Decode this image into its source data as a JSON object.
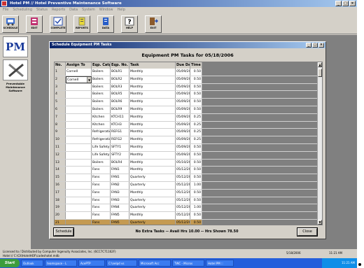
{
  "app": {
    "title": "Hotel PM // Hotel Preventive Maintenance Software",
    "menu": [
      "File",
      "Scheduling",
      "Status",
      "Reports",
      "Data",
      "System",
      "Window",
      "Help"
    ]
  },
  "toolbar": [
    {
      "label": "SCHEDULE",
      "icon": "schedule-icon"
    },
    {
      "label": "EDIT",
      "icon": "edit-icon"
    },
    {
      "label": "COMPLETE",
      "icon": "complete-icon"
    },
    {
      "label": "REPORTS",
      "icon": "reports-icon"
    },
    {
      "label": "DATA",
      "icon": "data-icon"
    },
    {
      "label": "HELP",
      "icon": "help-icon"
    },
    {
      "label": "EXIT",
      "icon": "exit-icon"
    }
  ],
  "sidebar": {
    "logo_text": "PM",
    "caption": "Preventable Maintenance Software"
  },
  "window": {
    "title": "Schedule Equipment PM Tasks",
    "heading": "Equipment PM Tasks for 05/18/2006",
    "columns": [
      "No.",
      "Assign To",
      "Eqp. Catg",
      "Eqp. No.",
      "Task",
      "Due Date",
      "Time"
    ],
    "rows": [
      [
        "1",
        "Cornell",
        "Boilers",
        "BOLR1",
        "Monthly",
        "05/09/2006",
        "0.50"
      ],
      [
        "2",
        "Cornell",
        "Boilers",
        "BOLR2",
        "Monthly",
        "05/09/2006",
        "0.50"
      ],
      [
        "3",
        "",
        "Boilers",
        "BOLR3",
        "Monthly",
        "05/09/2006",
        "0.50"
      ],
      [
        "4",
        "",
        "Boilers",
        "BOLR5",
        "Monthly",
        "05/09/2006",
        "0.50"
      ],
      [
        "5",
        "",
        "Boilers",
        "BOLR6",
        "Monthly",
        "05/09/2006",
        "0.50"
      ],
      [
        "6",
        "",
        "Boilers",
        "BOLR9",
        "Monthly",
        "05/09/2006",
        "0.50"
      ],
      [
        "7",
        "",
        "Kitchen",
        "KTCH11",
        "Monthly",
        "05/09/2006",
        "0.25"
      ],
      [
        "8",
        "",
        "Kitchen",
        "KTCH3",
        "Monthly",
        "05/09/2006",
        "0.25"
      ],
      [
        "9",
        "",
        "Refrigeration",
        "REFG1",
        "Monthly",
        "05/09/2006",
        "0.25"
      ],
      [
        "10",
        "",
        "Refrigeration",
        "REFG2",
        "Monthly",
        "05/09/2006",
        "0.25"
      ],
      [
        "11",
        "",
        "Life Safety",
        "SFTY1",
        "Monthly",
        "05/09/2006",
        "0.50"
      ],
      [
        "12",
        "",
        "Life Safety",
        "SFTY2",
        "Monthly",
        "05/09/2006",
        "0.50"
      ],
      [
        "13",
        "",
        "Boilers",
        "BOLR4",
        "Monthly",
        "05/10/2006",
        "0.50"
      ],
      [
        "14",
        "",
        "Fans",
        "FAN1",
        "Monthly",
        "05/12/2006",
        "0.50"
      ],
      [
        "15",
        "",
        "Fans",
        "FAN1",
        "Quarterly",
        "05/12/2006",
        "0.50"
      ],
      [
        "16",
        "",
        "Fans",
        "FAN2",
        "Quarterly",
        "05/12/2006",
        "1.00"
      ],
      [
        "17",
        "",
        "Fans",
        "FAN3",
        "Monthly",
        "05/12/2006",
        "0.50"
      ],
      [
        "18",
        "",
        "Fans",
        "FAN3",
        "Quarterly",
        "05/12/2006",
        "0.50"
      ],
      [
        "19",
        "",
        "Fans",
        "FAN4",
        "Quarterly",
        "05/12/2006",
        "1.00"
      ],
      [
        "20",
        "",
        "Fans",
        "FAN5",
        "Monthly",
        "05/12/2006",
        "0.50"
      ],
      [
        "21",
        "",
        "Fans",
        "FAN5",
        "Quarterly",
        "05/12/2006",
        "0.50"
      ]
    ],
    "schedule_button": "Schedule",
    "summary": "No Extra Tasks -- Avail Hrs 10.00 -- Hrs Shown 78.50",
    "close_button": "Close"
  },
  "status": {
    "line1": "Licensed to / Distributed by Computer Ingenuity Associates, Inc. (6CC7C71162F)",
    "line2": "Hotel // C:\\Cit\\HotelHOF\\cadeshotel.mdb",
    "date": "5/18/2006",
    "time": "11:21 AM"
  },
  "taskbar": {
    "start": "Start",
    "tasks": [
      "Outlook",
      "teamspace - L",
      "AcePTP",
      "C:\\nelpd vs",
      "Microsoft Acc",
      "TWC - Micros",
      "Hotel PM ::"
    ],
    "clock": "11:21 AM"
  }
}
